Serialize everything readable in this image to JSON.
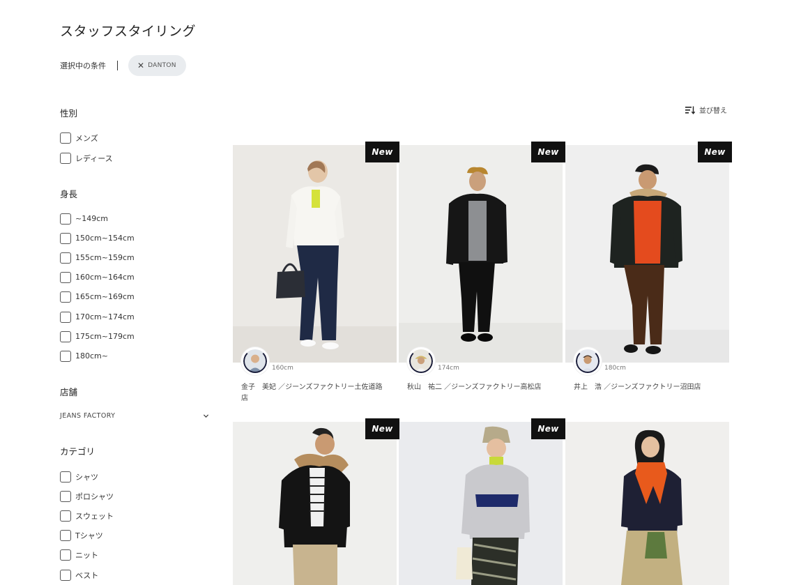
{
  "page": {
    "title": "スタッフスタイリング"
  },
  "conditions": {
    "label": "選択中の条件",
    "chip": {
      "close_glyph": "✕",
      "label": "DANTON"
    }
  },
  "filters": {
    "gender": {
      "title": "性別",
      "options": [
        "メンズ",
        "レディース"
      ]
    },
    "height": {
      "title": "身長",
      "options": [
        "~149cm",
        "150cm~154cm",
        "155cm~159cm",
        "160cm~164cm",
        "165cm~169cm",
        "170cm~174cm",
        "175cm~179cm",
        "180cm~"
      ]
    },
    "store": {
      "title": "店舗",
      "selected": "JEANS FACTORY"
    },
    "category": {
      "title": "カテゴリ",
      "options": [
        "シャツ",
        "ポロシャツ",
        "スウェット",
        "Tシャツ",
        "ニット",
        "ベスト"
      ]
    }
  },
  "sort": {
    "label": "並び替え",
    "icon": "sort-icon"
  },
  "cards": [
    {
      "new": true,
      "badge": "New",
      "height": "160cm",
      "name": "金子　美妃 ／ジーンズファクトリー土佐道路店"
    },
    {
      "new": true,
      "badge": "New",
      "height": "174cm",
      "name": "秋山　祐二 ／ジーンズファクトリー高松店"
    },
    {
      "new": true,
      "badge": "New",
      "height": "180cm",
      "name": "井上　浩 ／ジーンズファクトリー沼田店"
    },
    {
      "new": true,
      "badge": "New"
    },
    {
      "new": true,
      "badge": "New"
    },
    {
      "new": false
    }
  ]
}
